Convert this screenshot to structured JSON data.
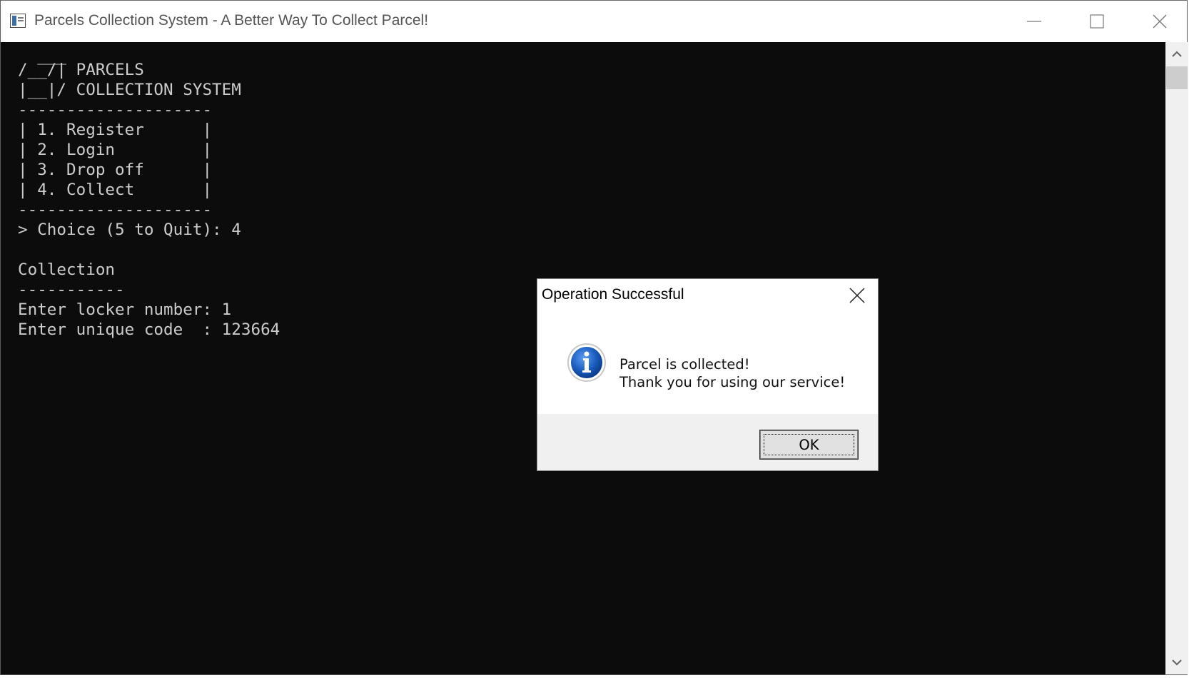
{
  "window": {
    "title": "Parcels Collection System - A Better Way To Collect Parcel!",
    "controls": [
      "minimize-icon",
      "maximize-icon",
      "close-icon"
    ]
  },
  "console": {
    "lines": [
      "  ___",
      "/__/| PARCELS",
      "|__|/ COLLECTION SYSTEM",
      "--------------------",
      "| 1. Register      |",
      "| 2. Login         |",
      "| 3. Drop off      |",
      "| 4. Collect       |",
      "--------------------",
      "> Choice (5 to Quit): 4",
      "",
      "Collection",
      "-----------",
      "Enter locker number: 1",
      "Enter unique code  : 123664"
    ],
    "background": "#0c0c0c",
    "text_color": "#cccccc"
  },
  "scrollbar": {
    "up_icon": "chevron-up-icon",
    "down_icon": "chevron-down-icon"
  },
  "dialog": {
    "title": "Operation Successful",
    "icon": "info-icon",
    "message_line1": "Parcel is collected!",
    "message_line2": "Thank you for using our service!",
    "ok_label": "OK",
    "accent": "#1b5fc1"
  }
}
